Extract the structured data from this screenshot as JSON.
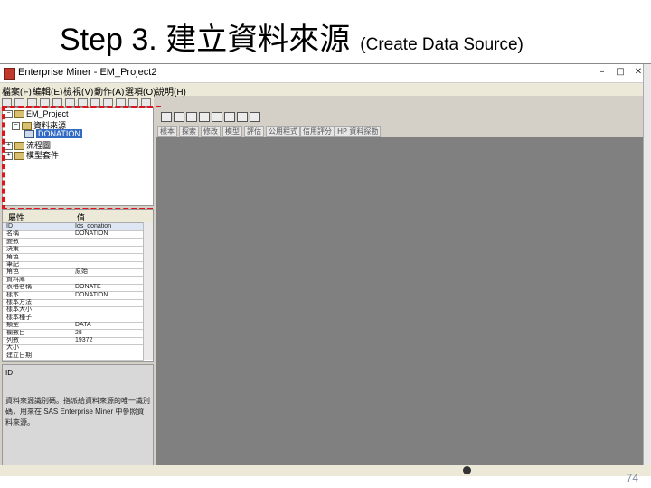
{
  "slide": {
    "title_main": "Step 3. 建立資料來源",
    "title_sub": "(Create Data Source)",
    "page_number": "74"
  },
  "window": {
    "title": "Enterprise Miner - EM_Project2",
    "min_label": "–",
    "max_label": "□",
    "close_label": "✕"
  },
  "menu": {
    "items": [
      "檔案(F)",
      "編輯(E)",
      "檢視(V)",
      "動作(A)",
      "選項(O)",
      "說明(H)"
    ]
  },
  "tree": {
    "items": [
      {
        "label": "EM_Project"
      },
      {
        "label": "資料來源"
      },
      {
        "label": "DONATION"
      },
      {
        "label": "流程圖"
      },
      {
        "label": "模型套件"
      }
    ]
  },
  "diagram_tabs": [
    "樣本",
    "探索",
    "修改",
    "模型",
    "評估",
    "公用程式",
    "信用評分",
    "HP 資料探勘"
  ],
  "properties": {
    "header_property": "屬性",
    "header_value": "值",
    "rows": [
      {
        "name": "ID",
        "value": "Ids_donation"
      },
      {
        "name": "名稱",
        "value": "DONATION"
      },
      {
        "name": "變數",
        "value": ""
      },
      {
        "name": "決策",
        "value": ""
      },
      {
        "name": "角色",
        "value": ""
      },
      {
        "name": "筆記",
        "value": ""
      },
      {
        "name": "角色",
        "value": "原始"
      },
      {
        "name": "資料庫",
        "value": ""
      },
      {
        "name": "表格名稱",
        "value": "DONATE"
      },
      {
        "name": "樣本",
        "value": "DONATION"
      },
      {
        "name": "樣本方法",
        "value": ""
      },
      {
        "name": "樣本大小",
        "value": ""
      },
      {
        "name": "樣本種子",
        "value": ""
      },
      {
        "name": "類型",
        "value": "DATA"
      },
      {
        "name": "欄數目",
        "value": "28"
      },
      {
        "name": "列數",
        "value": "19372"
      },
      {
        "name": "大小",
        "value": ""
      },
      {
        "name": "建立日期",
        "value": ""
      }
    ]
  },
  "description": {
    "title": "ID",
    "text": "資料來源識別碼。指派給資料來源的唯一識別碼，用來在 SAS Enterprise Miner 中參照資料來源。"
  }
}
